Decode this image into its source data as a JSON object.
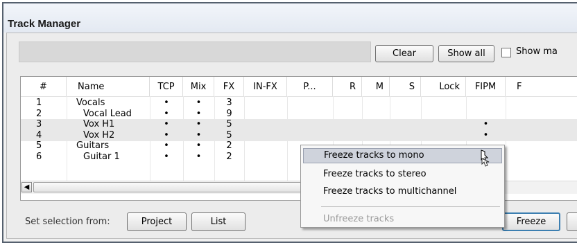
{
  "window": {
    "title": "Track Manager"
  },
  "toolbar": {
    "clear_label": "Clear",
    "show_all_label": "Show all",
    "show_checkbox_label": "Show ma"
  },
  "columns": [
    "#",
    "Name",
    "TCP",
    "Mix",
    "FX",
    "IN-FX",
    "P...",
    "R",
    "M",
    "S",
    "Lock",
    "FIPM",
    "F"
  ],
  "rows": [
    {
      "num": "1",
      "name": "Vocals",
      "tcp": "•",
      "mix": "•",
      "fx": "3",
      "fipm": "",
      "selected": false,
      "indent": 0
    },
    {
      "num": "2",
      "name": "Vocal Lead",
      "tcp": "•",
      "mix": "•",
      "fx": "9",
      "fipm": "",
      "selected": false,
      "indent": 1
    },
    {
      "num": "3",
      "name": "Vox H1",
      "tcp": "•",
      "mix": "•",
      "fx": "5",
      "fipm": "•",
      "selected": true,
      "indent": 1
    },
    {
      "num": "4",
      "name": "Vox H2",
      "tcp": "•",
      "mix": "•",
      "fx": "5",
      "fipm": "•",
      "selected": true,
      "indent": 1
    },
    {
      "num": "5",
      "name": "Guitars",
      "tcp": "•",
      "mix": "•",
      "fx": "2",
      "fipm": "",
      "selected": false,
      "indent": 0
    },
    {
      "num": "6",
      "name": "Guitar 1",
      "tcp": "•",
      "mix": "•",
      "fx": "2",
      "fipm": "",
      "selected": false,
      "indent": 1
    }
  ],
  "footer": {
    "set_selection_label": "Set selection from:",
    "project_label": "Project",
    "list_label": "List",
    "freeze_label": "Freeze"
  },
  "context_menu": {
    "items": [
      {
        "label": "Freeze tracks to mono",
        "highlighted": true,
        "disabled": false
      },
      {
        "label": "Freeze tracks to stereo",
        "highlighted": false,
        "disabled": false
      },
      {
        "label": "Freeze tracks to multichannel",
        "highlighted": false,
        "disabled": false
      },
      {
        "label": "Unfreeze tracks",
        "highlighted": false,
        "disabled": true
      }
    ]
  },
  "icons": {
    "scroll_left": "chevron-left-icon",
    "cursor": "mouse-pointer-icon"
  },
  "colors": {
    "selected_row": "#e8e8e8",
    "menu_highlight": "#cfd3dc",
    "freeze_border": "#3c7fb1"
  }
}
